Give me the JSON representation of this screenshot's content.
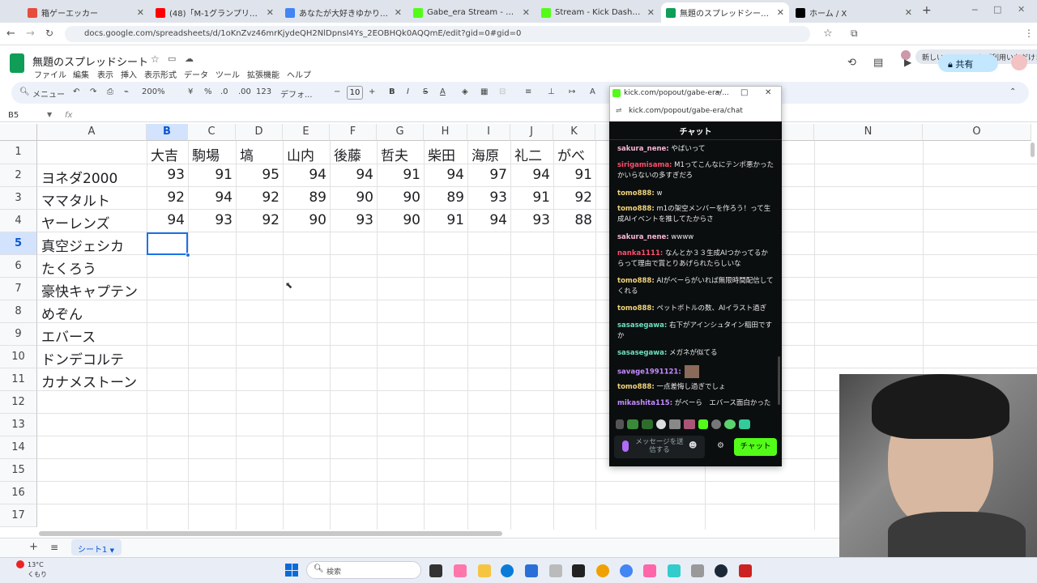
{
  "browser": {
    "tabs": [
      {
        "label": "箱ゲーエッカー",
        "color": "#e74c3c"
      },
      {
        "label": "(48)「M-1グランプリ」を観ながら雑",
        "color": "#ff0000"
      },
      {
        "label": "あなたが大好きゆかりちゃん~(ん",
        "color": "#4285f4"
      },
      {
        "label": "Gabe_era Stream - Watch Live",
        "color": "#53fc18"
      },
      {
        "label": "Stream - Kick Dashboard",
        "color": "#53fc18"
      },
      {
        "label": "無題のスプレッドシート - Google ス",
        "color": "#0f9d58"
      },
      {
        "label": "ホーム / X",
        "color": "#000000"
      }
    ],
    "url": "docs.google.com/spreadsheets/d/1oKnZvz46mrKjydeQH2NlDpnsI4Ys_2EOBHQk0AQQmE/edit?gid=0#gid=0",
    "chrome_badge": "新しい Chrome をご利用いただけます"
  },
  "docs": {
    "title": "無題のスプレッドシート",
    "menus": [
      "ファイル",
      "編集",
      "表示",
      "挿入",
      "表示形式",
      "データ",
      "ツール",
      "拡張機能",
      "ヘルプ"
    ],
    "share": "共有",
    "menu_search": "メニュー",
    "zoom": "200%",
    "currency": "¥",
    "percent": "%",
    "dec_minus": ".0",
    "dec_plus": ".00",
    "num_fmt": "123",
    "font": "デフォ...",
    "font_size": "10",
    "name_box": "B5",
    "fx": "fx"
  },
  "sheet": {
    "columns": [
      "A",
      "B",
      "C",
      "D",
      "E",
      "F",
      "G",
      "H",
      "I",
      "J",
      "K",
      "N",
      "O"
    ],
    "rows": [
      "1",
      "2",
      "3",
      "4",
      "5",
      "6",
      "7",
      "8",
      "9",
      "10",
      "11",
      "12",
      "13",
      "14",
      "15",
      "16",
      "17"
    ],
    "header": [
      "",
      "大吉",
      "駒場",
      "塙",
      "山内",
      "後藤",
      "哲夫",
      "柴田",
      "海原",
      "礼二",
      "がべ"
    ],
    "data": [
      [
        "ヨネダ2000",
        "93",
        "91",
        "95",
        "94",
        "94",
        "91",
        "94",
        "97",
        "94",
        "91"
      ],
      [
        "ママタルト",
        "92",
        "94",
        "92",
        "89",
        "90",
        "90",
        "89",
        "93",
        "91",
        "92"
      ],
      [
        "ヤーレンズ",
        "94",
        "93",
        "92",
        "90",
        "93",
        "90",
        "91",
        "94",
        "93",
        "88"
      ],
      [
        "真空ジェシカ"
      ],
      [
        "たくろう"
      ],
      [
        "豪快キャプテン"
      ],
      [
        "めぞん"
      ],
      [
        "エバース"
      ],
      [
        "ドンデコルテ"
      ],
      [
        "カナメストーン"
      ]
    ],
    "sheet_tab": "シート1"
  },
  "popup": {
    "title": "kick.com/popout/gabe-era/...",
    "url": "kick.com/popout/gabe-era/chat",
    "chat_title": "チャット",
    "messages": [
      {
        "user": "sakura_nene:",
        "text": "やばいって",
        "color": "#f7b8d4"
      },
      {
        "user": "sirigamisama:",
        "text": "M1ってこんなにテンポ悪かったかいらないの多すぎだろ",
        "color": "#ff4d6d"
      },
      {
        "user": "tomo888:",
        "text": "w",
        "color": "#f0d37a"
      },
      {
        "user": "tomo888:",
        "text": "m1の架空メンバーを作ろう！って生成AIイベントを推してたからさ",
        "color": "#f0d37a"
      },
      {
        "user": "sakura_nene:",
        "text": "wwww",
        "color": "#f7b8d4"
      },
      {
        "user": "nanka1111:",
        "text": "なんとか３３生成AIつかってるからって理由で賞とりあげられたらしいな",
        "color": "#ff4d6d"
      },
      {
        "user": "tomo888:",
        "text": "AIがべーらがいれば無限時間配信してくれる",
        "color": "#f0d37a"
      },
      {
        "user": "tomo888:",
        "text": "ペットボトルの数、AIイラスト過ぎ",
        "color": "#f0d37a"
      },
      {
        "user": "sasasegawa:",
        "text": "右下がアインシュタイン稲田ですか",
        "color": "#6ce0c0"
      },
      {
        "user": "sasasegawa:",
        "text": "メガネが似てる",
        "color": "#6ce0c0"
      },
      {
        "user": "savage1991121:",
        "text": "",
        "color": "#c58bff"
      },
      {
        "user": "tomo888:",
        "text": "一点差悔し過ぎでしょ",
        "color": "#f0d37a"
      },
      {
        "user": "mikashita115:",
        "text": "がべーら　エバース面白かった",
        "color": "#c58bff"
      }
    ],
    "input_placeholder": "メッセージを送信する",
    "send": "チャット"
  },
  "taskbar": {
    "weather_temp": "13°C",
    "weather_desc": "くもり",
    "search": "検索"
  },
  "colors": {
    "accent": "#1a73e8",
    "kick": "#53fc18",
    "sheets": "#0f9d58"
  }
}
